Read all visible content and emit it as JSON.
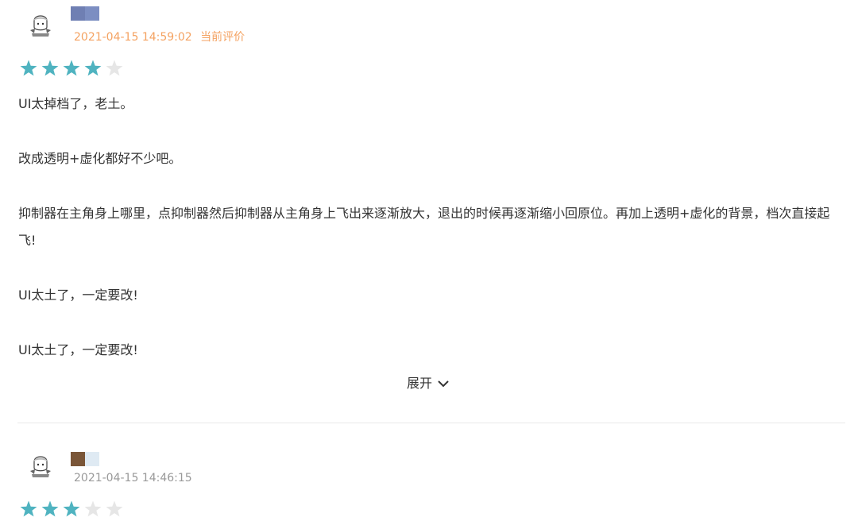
{
  "reviews": [
    {
      "user_icon": "avatar-icon",
      "name_colors": [
        "#6f7fb3",
        "#7c8ec2"
      ],
      "time": "2021-04-15 14:59:02",
      "current_label": "当前评价",
      "rating": 4,
      "rating_max": 5,
      "star_color": "#4fb3c0",
      "star_empty_color": "#e6e6e6",
      "paragraphs": [
        "UI太掉档了，老土。",
        "改成透明+虚化都好不少吧。",
        "抑制器在主角身上哪里，点抑制器然后抑制器从主角身上飞出来逐渐放大，退出的时候再逐渐缩小回原位。再加上透明+虚化的背景，档次直接起飞!",
        "UI太土了，一定要改!",
        "UI太土了，一定要改!"
      ],
      "expand_label": "展开"
    },
    {
      "user_icon": "avatar-icon",
      "name_colors": [
        "#7a5638",
        "#dfeaf3"
      ],
      "time": "2021-04-15 14:46:15",
      "rating": 3,
      "rating_max": 5,
      "star_color": "#4fb3c0",
      "star_empty_color": "#e6e6e6"
    }
  ]
}
